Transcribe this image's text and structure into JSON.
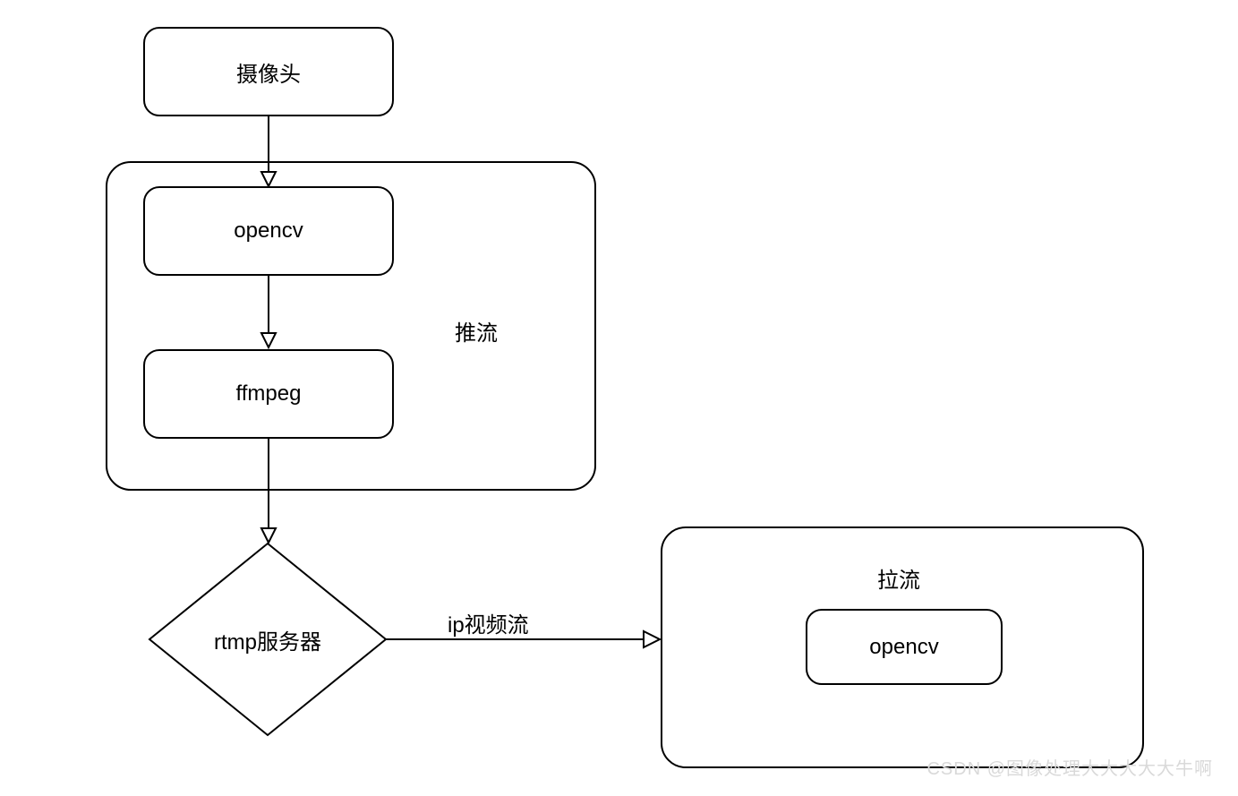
{
  "nodes": {
    "camera": "摄像头",
    "opencv": "opencv",
    "ffmpeg": "ffmpeg",
    "push_container": "推流",
    "rtmp": "rtmp服务器",
    "ip_stream": "ip视频流",
    "pull_container": "拉流",
    "opencv2": "opencv"
  },
  "watermark": "CSDN @图像处理大大大大大牛啊"
}
